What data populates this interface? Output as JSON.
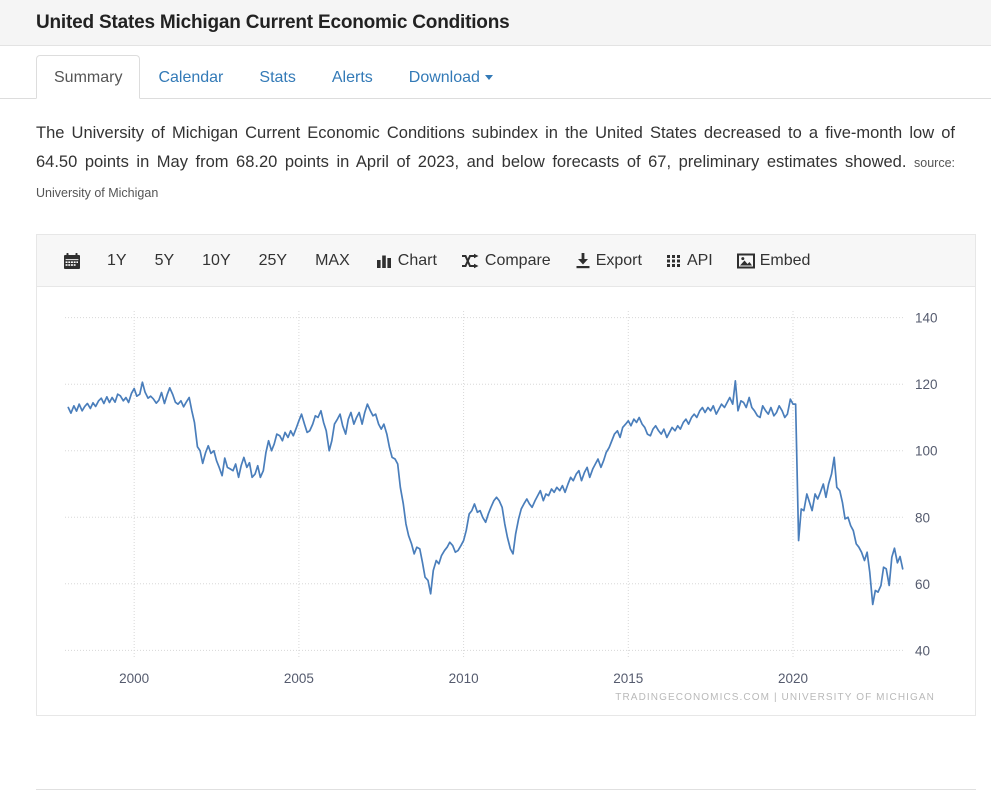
{
  "header": {
    "title": "United States Michigan Current Economic Conditions"
  },
  "tabs": [
    {
      "label": "Summary",
      "active": true
    },
    {
      "label": "Calendar",
      "active": false
    },
    {
      "label": "Stats",
      "active": false
    },
    {
      "label": "Alerts",
      "active": false
    },
    {
      "label": "Download",
      "active": false,
      "has_caret": true
    }
  ],
  "description": {
    "text": "The University of Michigan Current Economic Conditions subindex in the United States decreased to a five-month low of 64.50 points in May from 68.20 points in April of 2023, and below forecasts of 67, preliminary estimates showed.",
    "source": "source: University of Michigan"
  },
  "chart_toolbar": {
    "calendar_icon": "calendar-icon",
    "ranges": [
      "1Y",
      "5Y",
      "10Y",
      "25Y",
      "MAX"
    ],
    "actions": [
      {
        "label": "Chart",
        "icon": "bar-chart-icon"
      },
      {
        "label": "Compare",
        "icon": "shuffle-icon"
      },
      {
        "label": "Export",
        "icon": "download-icon"
      },
      {
        "label": "API",
        "icon": "grid-dots-icon"
      },
      {
        "label": "Embed",
        "icon": "image-icon"
      }
    ]
  },
  "chart_credit": "TRADINGECONOMICS.COM  |  UNIVERSITY OF MICHIGAN",
  "colors": {
    "line": "#4a7ebb",
    "grid": "#d8d8d8",
    "tick_text": "#555b6e",
    "tab_link": "#337ab7",
    "header_bg": "#f5f5f5",
    "toolbar_bg": "#f7f7f7"
  },
  "chart_data": {
    "type": "line",
    "title": "United States Michigan Current Economic Conditions",
    "xlabel": "",
    "ylabel": "",
    "xlim": [
      1997.9,
      2023.4
    ],
    "ylim": [
      38,
      142
    ],
    "ytick_values": [
      40,
      60,
      80,
      100,
      120,
      140
    ],
    "xtick_values": [
      2000,
      2005,
      2010,
      2015,
      2020
    ],
    "grid": true,
    "legend": "none",
    "series": [
      {
        "name": "Michigan Current Economic Conditions",
        "units": "points",
        "latest_value": 64.5,
        "previous_value": 68.2,
        "forecast": 67,
        "x": [
          1998.0,
          1998.08,
          1998.17,
          1998.25,
          1998.33,
          1998.42,
          1998.5,
          1998.58,
          1998.67,
          1998.75,
          1998.83,
          1998.92,
          1999.0,
          1999.08,
          1999.17,
          1999.25,
          1999.33,
          1999.42,
          1999.5,
          1999.58,
          1999.67,
          1999.75,
          1999.83,
          1999.92,
          2000.0,
          2000.08,
          2000.17,
          2000.25,
          2000.33,
          2000.42,
          2000.5,
          2000.58,
          2000.67,
          2000.75,
          2000.83,
          2000.92,
          2001.0,
          2001.08,
          2001.17,
          2001.25,
          2001.33,
          2001.42,
          2001.5,
          2001.58,
          2001.67,
          2001.75,
          2001.83,
          2001.92,
          2002.0,
          2002.08,
          2002.17,
          2002.25,
          2002.33,
          2002.42,
          2002.5,
          2002.58,
          2002.67,
          2002.75,
          2002.83,
          2002.92,
          2003.0,
          2003.08,
          2003.17,
          2003.25,
          2003.33,
          2003.42,
          2003.5,
          2003.58,
          2003.67,
          2003.75,
          2003.83,
          2003.92,
          2004.0,
          2004.08,
          2004.17,
          2004.25,
          2004.33,
          2004.42,
          2004.5,
          2004.58,
          2004.67,
          2004.75,
          2004.83,
          2004.92,
          2005.0,
          2005.08,
          2005.17,
          2005.25,
          2005.33,
          2005.42,
          2005.5,
          2005.58,
          2005.67,
          2005.75,
          2005.83,
          2005.92,
          2006.0,
          2006.08,
          2006.17,
          2006.25,
          2006.33,
          2006.42,
          2006.5,
          2006.58,
          2006.67,
          2006.75,
          2006.83,
          2006.92,
          2007.0,
          2007.08,
          2007.17,
          2007.25,
          2007.33,
          2007.42,
          2007.5,
          2007.58,
          2007.67,
          2007.75,
          2007.83,
          2007.92,
          2008.0,
          2008.08,
          2008.17,
          2008.25,
          2008.33,
          2008.42,
          2008.5,
          2008.58,
          2008.67,
          2008.75,
          2008.83,
          2008.92,
          2009.0,
          2009.08,
          2009.17,
          2009.25,
          2009.33,
          2009.42,
          2009.5,
          2009.58,
          2009.67,
          2009.75,
          2009.83,
          2009.92,
          2010.0,
          2010.08,
          2010.17,
          2010.25,
          2010.33,
          2010.42,
          2010.5,
          2010.58,
          2010.67,
          2010.75,
          2010.83,
          2010.92,
          2011.0,
          2011.08,
          2011.17,
          2011.25,
          2011.33,
          2011.42,
          2011.5,
          2011.58,
          2011.67,
          2011.75,
          2011.83,
          2011.92,
          2012.0,
          2012.08,
          2012.17,
          2012.25,
          2012.33,
          2012.42,
          2012.5,
          2012.58,
          2012.67,
          2012.75,
          2012.83,
          2012.92,
          2013.0,
          2013.08,
          2013.17,
          2013.25,
          2013.33,
          2013.42,
          2013.5,
          2013.58,
          2013.67,
          2013.75,
          2013.83,
          2013.92,
          2014.0,
          2014.08,
          2014.17,
          2014.25,
          2014.33,
          2014.42,
          2014.5,
          2014.58,
          2014.67,
          2014.75,
          2014.83,
          2014.92,
          2015.0,
          2015.08,
          2015.17,
          2015.25,
          2015.33,
          2015.42,
          2015.5,
          2015.58,
          2015.67,
          2015.75,
          2015.83,
          2015.92,
          2016.0,
          2016.08,
          2016.17,
          2016.25,
          2016.33,
          2016.42,
          2016.5,
          2016.58,
          2016.67,
          2016.75,
          2016.83,
          2016.92,
          2017.0,
          2017.08,
          2017.17,
          2017.25,
          2017.33,
          2017.42,
          2017.5,
          2017.58,
          2017.67,
          2017.75,
          2017.83,
          2017.92,
          2018.0,
          2018.08,
          2018.17,
          2018.25,
          2018.33,
          2018.42,
          2018.5,
          2018.58,
          2018.67,
          2018.75,
          2018.83,
          2018.92,
          2019.0,
          2019.08,
          2019.17,
          2019.25,
          2019.33,
          2019.42,
          2019.5,
          2019.58,
          2019.67,
          2019.75,
          2019.83,
          2019.92,
          2020.0,
          2020.08,
          2020.17,
          2020.25,
          2020.33,
          2020.42,
          2020.5,
          2020.58,
          2020.67,
          2020.75,
          2020.83,
          2020.92,
          2021.0,
          2021.08,
          2021.17,
          2021.25,
          2021.33,
          2021.42,
          2021.5,
          2021.58,
          2021.67,
          2021.75,
          2021.83,
          2021.92,
          2022.0,
          2022.08,
          2022.17,
          2022.25,
          2022.33,
          2022.42,
          2022.5,
          2022.58,
          2022.67,
          2022.75,
          2022.83,
          2022.92,
          2023.0,
          2023.08,
          2023.17,
          2023.25,
          2023.33
        ],
        "y": [
          113.0,
          111.3,
          113.5,
          111.9,
          114.0,
          112.0,
          113.3,
          114.2,
          112.7,
          114.4,
          113.3,
          115.0,
          115.8,
          114.2,
          116.2,
          114.5,
          116.0,
          114.6,
          117.0,
          116.5,
          115.0,
          116.0,
          114.5,
          117.3,
          118.7,
          116.4,
          117.0,
          120.6,
          117.6,
          115.8,
          116.4,
          115.6,
          114.3,
          115.2,
          117.5,
          114.2,
          116.8,
          118.9,
          116.9,
          114.6,
          114.0,
          115.0,
          113.2,
          114.6,
          116.0,
          112.0,
          108.5,
          101.2,
          100.0,
          96.2,
          99.5,
          101.5,
          99.2,
          100.0,
          97.0,
          95.0,
          92.5,
          97.8,
          95.0,
          94.5,
          94.0,
          96.0,
          92.0,
          95.6,
          98.0,
          95.0,
          96.4,
          92.0,
          93.0,
          95.5,
          92.0,
          94.0,
          99.5,
          103.0,
          100.0,
          102.0,
          105.0,
          104.5,
          103.0,
          105.5,
          104.0,
          106.0,
          104.5,
          106.8,
          109.0,
          111.0,
          108.0,
          105.5,
          106.0,
          108.0,
          110.5,
          110.0,
          112.0,
          108.5,
          106.0,
          100.0,
          103.0,
          108.0,
          109.5,
          111.0,
          107.5,
          105.0,
          109.5,
          111.5,
          108.0,
          110.0,
          111.5,
          108.0,
          111.5,
          114.0,
          112.0,
          110.5,
          111.0,
          108.0,
          106.5,
          108.0,
          105.0,
          101.0,
          98.0,
          97.5,
          96.0,
          89.0,
          84.0,
          78.0,
          74.5,
          72.0,
          69.0,
          71.0,
          70.5,
          66.5,
          62.0,
          61.0,
          57.0,
          64.0,
          67.0,
          66.0,
          68.5,
          70.0,
          71.0,
          72.5,
          71.5,
          69.5,
          70.0,
          71.5,
          73.0,
          76.0,
          81.0,
          82.0,
          84.0,
          81.5,
          82.0,
          80.0,
          78.5,
          81.0,
          83.0,
          85.0,
          86.0,
          85.0,
          83.0,
          78.0,
          74.0,
          70.5,
          69.0,
          75.0,
          79.5,
          82.5,
          84.0,
          85.5,
          84.0,
          83.0,
          85.0,
          86.5,
          88.0,
          85.0,
          87.0,
          86.5,
          88.5,
          87.5,
          89.0,
          88.0,
          89.5,
          87.5,
          90.0,
          92.0,
          91.0,
          93.0,
          94.0,
          91.0,
          93.5,
          95.0,
          92.0,
          94.5,
          96.0,
          97.5,
          95.0,
          97.0,
          99.5,
          101.0,
          103.0,
          105.0,
          106.0,
          104.0,
          107.0,
          108.0,
          109.0,
          107.5,
          109.5,
          108.5,
          110.0,
          108.0,
          107.0,
          105.0,
          104.5,
          106.5,
          107.5,
          106.0,
          105.0,
          106.5,
          104.0,
          105.5,
          107.0,
          106.0,
          107.5,
          106.5,
          108.5,
          109.5,
          108.0,
          110.0,
          111.0,
          110.0,
          112.0,
          113.0,
          111.5,
          113.0,
          112.0,
          113.5,
          111.0,
          112.5,
          114.0,
          113.0,
          114.5,
          116.0,
          114.0,
          121.0,
          112.0,
          115.0,
          114.5,
          113.0,
          116.0,
          113.0,
          112.0,
          110.5,
          110.0,
          113.5,
          112.0,
          111.0,
          113.0,
          110.5,
          111.5,
          113.5,
          112.0,
          110.0,
          111.0,
          115.5,
          114.0,
          114.0,
          73.0,
          82.5,
          82.0,
          87.0,
          84.5,
          82.0,
          87.0,
          85.5,
          87.5,
          90.0,
          86.0,
          90.0,
          93.0,
          98.0,
          89.0,
          88.0,
          84.5,
          79.5,
          80.0,
          77.5,
          76.0,
          72.0,
          71.0,
          69.5,
          67.0,
          69.5,
          63.5,
          53.8,
          58.0,
          57.5,
          59.5,
          65.0,
          64.5,
          59.5,
          68.0,
          70.7,
          66.3,
          68.2,
          64.5
        ]
      }
    ]
  }
}
